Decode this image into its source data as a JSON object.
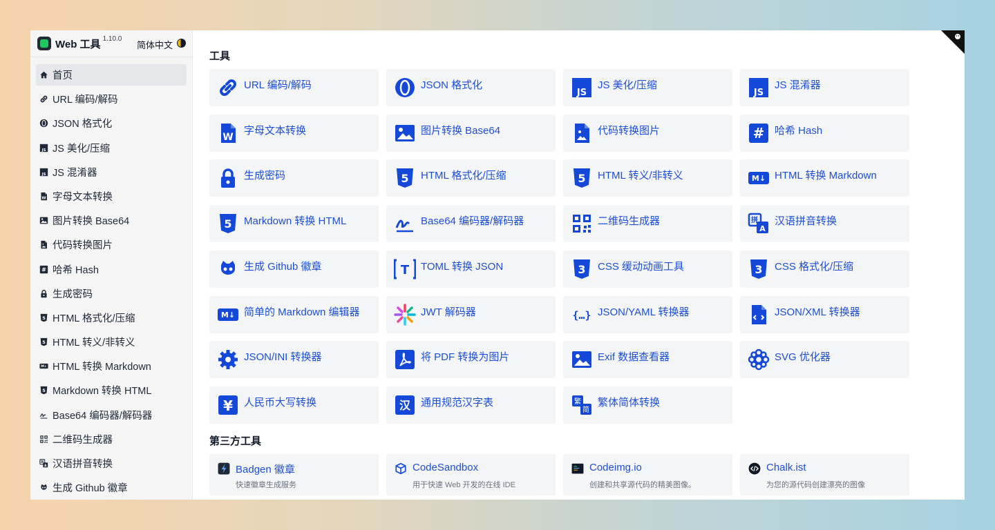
{
  "brand": {
    "name": "Web 工具",
    "version": "1.10.0",
    "language": "简体中文"
  },
  "sidebar": {
    "items": [
      {
        "label": "首页",
        "icon": "home-icon",
        "active": true
      },
      {
        "label": "URL 编码/解码",
        "icon": "link-icon"
      },
      {
        "label": "JSON 格式化",
        "icon": "json-icon"
      },
      {
        "label": "JS 美化/压缩",
        "icon": "js-file-icon"
      },
      {
        "label": "JS 混淆器",
        "icon": "js-file-icon"
      },
      {
        "label": "字母文本转换",
        "icon": "word-file-icon"
      },
      {
        "label": "图片转换 Base64",
        "icon": "image-icon"
      },
      {
        "label": "代码转换图片",
        "icon": "image-file-icon"
      },
      {
        "label": "哈希 Hash",
        "icon": "hash-icon"
      },
      {
        "label": "生成密码",
        "icon": "lock-icon"
      },
      {
        "label": "HTML 格式化/压缩",
        "icon": "html5-icon"
      },
      {
        "label": "HTML 转义/非转义",
        "icon": "html5-icon"
      },
      {
        "label": "HTML 转换 Markdown",
        "icon": "markdown-icon"
      },
      {
        "label": "Markdown 转换 HTML",
        "icon": "html5-icon"
      },
      {
        "label": "Base64 编码器/解码器",
        "icon": "signature-icon"
      },
      {
        "label": "二维码生成器",
        "icon": "qrcode-icon"
      },
      {
        "label": "汉语拼音转换",
        "icon": "translate-icon"
      },
      {
        "label": "生成 Github 徽章",
        "icon": "github-icon"
      }
    ]
  },
  "main": {
    "tools_title": "工具",
    "tools": [
      {
        "label": "URL 编码/解码",
        "icon": "link-icon"
      },
      {
        "label": "JSON 格式化",
        "icon": "json-icon"
      },
      {
        "label": "JS 美化/压缩",
        "icon": "js-file-icon"
      },
      {
        "label": "JS 混淆器",
        "icon": "js-file-icon"
      },
      {
        "label": "字母文本转换",
        "icon": "word-file-icon"
      },
      {
        "label": "图片转换 Base64",
        "icon": "image-icon"
      },
      {
        "label": "代码转换图片",
        "icon": "image-file-icon"
      },
      {
        "label": "哈希 Hash",
        "icon": "hash-icon"
      },
      {
        "label": "生成密码",
        "icon": "lock-icon"
      },
      {
        "label": "HTML 格式化/压缩",
        "icon": "html5-icon"
      },
      {
        "label": "HTML 转义/非转义",
        "icon": "html5-icon"
      },
      {
        "label": "HTML 转换 Markdown",
        "icon": "markdown-icon"
      },
      {
        "label": "Markdown 转换 HTML",
        "icon": "html5-icon"
      },
      {
        "label": "Base64 编码器/解码器",
        "icon": "signature-icon"
      },
      {
        "label": "二维码生成器",
        "icon": "qrcode-icon"
      },
      {
        "label": "汉语拼音转换",
        "icon": "translate-icon"
      },
      {
        "label": "生成 Github 徽章",
        "icon": "github-icon"
      },
      {
        "label": "TOML 转换 JSON",
        "icon": "toml-icon"
      },
      {
        "label": "CSS 缓动动画工具",
        "icon": "css3-icon"
      },
      {
        "label": "CSS 格式化/压缩",
        "icon": "css3-icon"
      },
      {
        "label": "简单的 Markdown 编辑器",
        "icon": "markdown-icon"
      },
      {
        "label": "JWT 解码器",
        "icon": "jwt-icon"
      },
      {
        "label": "JSON/YAML 转换器",
        "icon": "braces-icon"
      },
      {
        "label": "JSON/XML 转换器",
        "icon": "code-file-icon"
      },
      {
        "label": "JSON/INI 转换器",
        "icon": "gear-icon"
      },
      {
        "label": "将 PDF 转换为图片",
        "icon": "pdf-icon"
      },
      {
        "label": "Exif 数据查看器",
        "icon": "image-icon"
      },
      {
        "label": "SVG 优化器",
        "icon": "svg-icon"
      },
      {
        "label": "人民币大写转换",
        "icon": "yen-icon"
      },
      {
        "label": "通用规范汉字表",
        "icon": "hanzi-icon"
      },
      {
        "label": "繁体简体转换",
        "icon": "traditional-simplified-icon"
      }
    ],
    "third_party_title": "第三方工具",
    "third_party": [
      {
        "name": "Badgen 徽章",
        "desc": "快速徽章生成服务",
        "icon": "badgen-icon",
        "color": "#1f2937"
      },
      {
        "name": "CodeSandbox",
        "desc": "用于快速 Web 开发的在线 IDE",
        "icon": "cube-icon",
        "color": "#1d4ed8"
      },
      {
        "name": "Codeimg.io",
        "desc": "创建和共享源代码的精美图像。",
        "icon": "terminal-icon",
        "color": "#111827"
      },
      {
        "name": "Chalk.ist",
        "desc": "为您的源代码创建漂亮的图像",
        "icon": "code-circle-icon",
        "color": "#111827"
      }
    ]
  },
  "colors": {
    "link": "#1d4ed8",
    "icon_blue": "#1448d8",
    "card_bg": "#f4f5f7",
    "sidebar_bg": "#f5f5f6"
  }
}
